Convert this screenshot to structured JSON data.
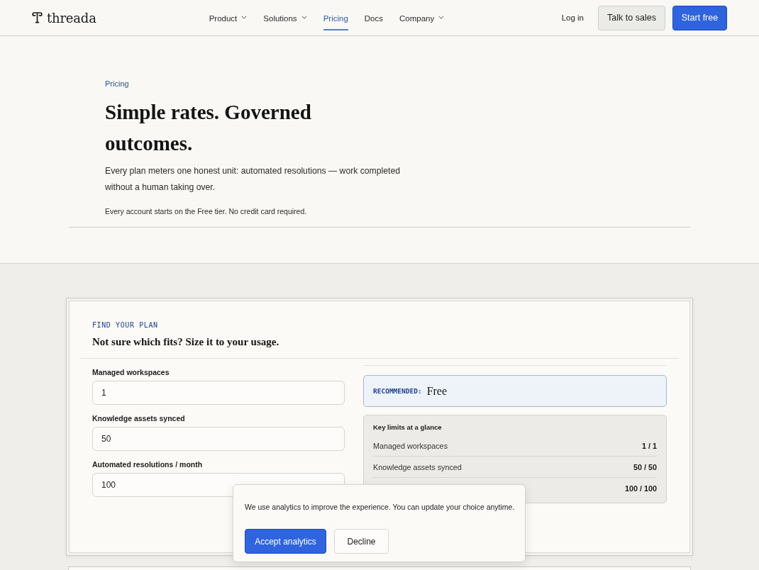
{
  "nav": {
    "logo": "threada",
    "items": [
      {
        "label": "Product",
        "dropdown": true,
        "selected": false
      },
      {
        "label": "Solutions",
        "dropdown": true,
        "selected": false
      },
      {
        "label": "Pricing",
        "dropdown": false,
        "selected": true
      },
      {
        "label": "Docs",
        "dropdown": false,
        "selected": false
      },
      {
        "label": "Company",
        "dropdown": true,
        "selected": false
      }
    ],
    "login": "Log in",
    "buttons": [
      {
        "label": "Talk to sales",
        "kind": "secondary"
      },
      {
        "label": "Start free",
        "kind": "primary"
      }
    ]
  },
  "hero": {
    "eyebrow": "Pricing",
    "title": "Simple rates. Governed outcomes.",
    "lead": "Every plan meters one honest unit: automated resolutions — work completed without a human taking over.",
    "note": "Every account starts on the Free tier. No credit card required."
  },
  "planner": {
    "eyebrow": "FIND YOUR PLAN",
    "title": "Not sure which fits? Size it to your usage.",
    "fields": [
      {
        "label": "Managed workspaces",
        "value": "1"
      },
      {
        "label": "Knowledge assets synced",
        "value": "50"
      },
      {
        "label": "Automated resolutions / month",
        "value": "100"
      }
    ],
    "recommendation": {
      "label": "RECOMMENDED:",
      "plan": "Free"
    },
    "limits": {
      "title": "Key limits at a glance",
      "rows": [
        {
          "label": "Managed workspaces",
          "value": "1 / 1"
        },
        {
          "label": "Knowledge assets synced",
          "value": "50 / 50"
        },
        {
          "value": "100 / 100"
        }
      ]
    }
  },
  "cookie_banner": {
    "text": "We use analytics to improve the experience. You can update your choice anytime.",
    "buttons": [
      {
        "label": "Accept analytics",
        "kind": "primary"
      },
      {
        "label": "Decline",
        "kind": "secondary"
      }
    ]
  }
}
